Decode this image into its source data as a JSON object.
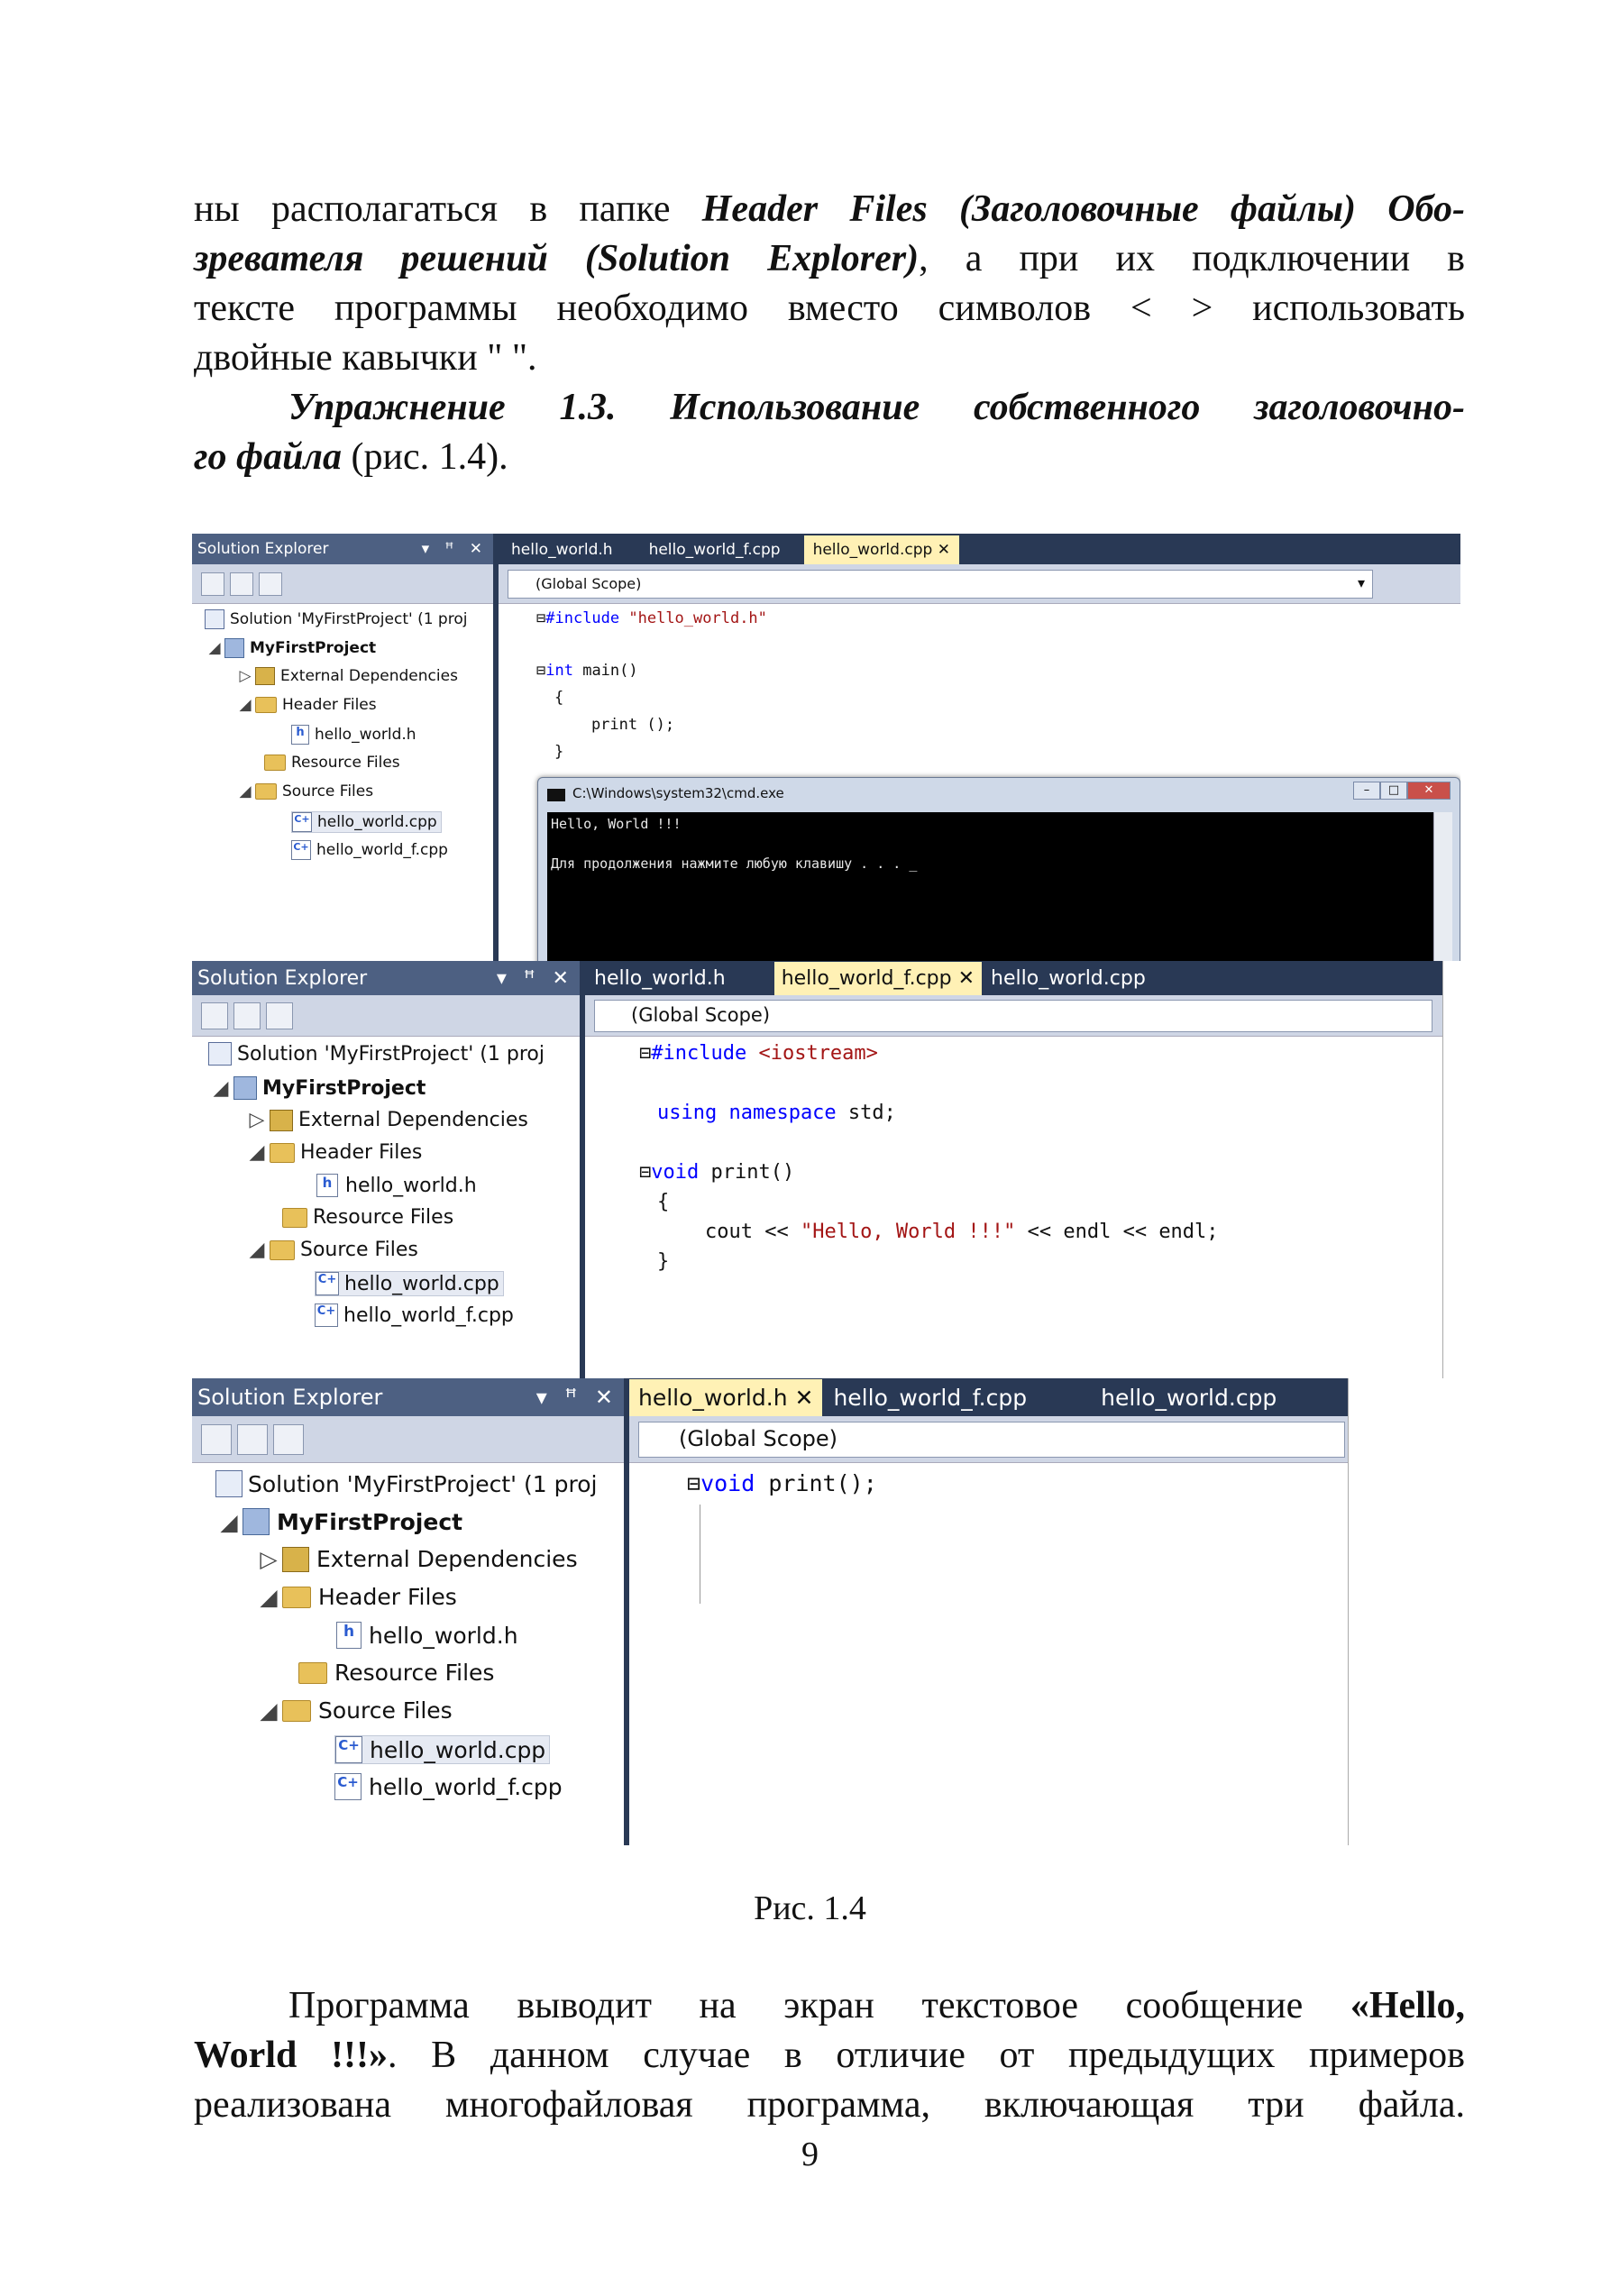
{
  "text": {
    "p1_l1_a": "ны располагаться в папке ",
    "p1_l1_b": "Header Files (Заголовочные файлы) Обо-",
    "p1_l2_a": "зревателя решений (Solution Explorer)",
    "p1_l2_b": ", а при их подключении в",
    "p1_l3": "тексте программы необходимо вместо символов < > использовать",
    "p1_l4": "двойные кавычки \" \".",
    "ex_l1": "Упражнение 1.3. Использование собственного заголовочно-",
    "ex_l2_a": "го файла",
    "ex_l2_b": " (рис. 1.4).",
    "caption": "Рис. 1.4",
    "p2_l1_a": "Программа выводит на экран текстовое сообщение ",
    "p2_l1_b": "«Hello,",
    "p2_l2_a": "World !!!»",
    "p2_l2_b": ". В данном случае в отличие от предыдущих примеров",
    "p2_l3": "реализована многофайловая программа, включающая три файла.",
    "page_number": "9"
  },
  "explorer": {
    "title": "Solution Explorer",
    "controls": "▾ ꟸ ✕",
    "solution": "Solution 'MyFirstProject' (1 proj",
    "project": "MyFirstProject",
    "external": "External Dependencies",
    "header_files": "Header Files",
    "header_file": "hello_world.h",
    "resource_files": "Resource Files",
    "source_files": "Source Files",
    "source_file1": "hello_world.cpp",
    "source_file2": "hello_world_f.cpp",
    "file_badge_h": "h",
    "file_badge_cpp": "C+"
  },
  "tabs": {
    "h": "hello_world.h",
    "f": "hello_world_f.cpp",
    "main": "hello_world.cpp",
    "close": "✕"
  },
  "scope": "(Global Scope)",
  "code_main": {
    "l1_kw": "#include",
    "l1_str": " \"hello_world.h\"",
    "l2_kw": "int",
    "l2_rest": " main()",
    "l3": "{",
    "l4": "    print ();",
    "l5": "}"
  },
  "code_f": {
    "l1_kw": "#include",
    "l1_str": " <iostream>",
    "l2_kw": "using namespace",
    "l2_rest": " std;",
    "l3_kw": "void",
    "l3_rest": " print()",
    "l4": "{",
    "l5_a": "    cout << ",
    "l5_str": "\"Hello, World !!!\"",
    "l5_b": " << endl << endl;",
    "l6": "}"
  },
  "code_h": {
    "l1_kw": "void",
    "l1_rest": " print();"
  },
  "cmd": {
    "title": "C:\\Windows\\system32\\cmd.exe",
    "line1": "Hello, World !!!",
    "line2": "Для продолжения нажмите любую клавишу . . . _",
    "btn_min": "–",
    "btn_max": "□",
    "btn_close": "✕"
  }
}
